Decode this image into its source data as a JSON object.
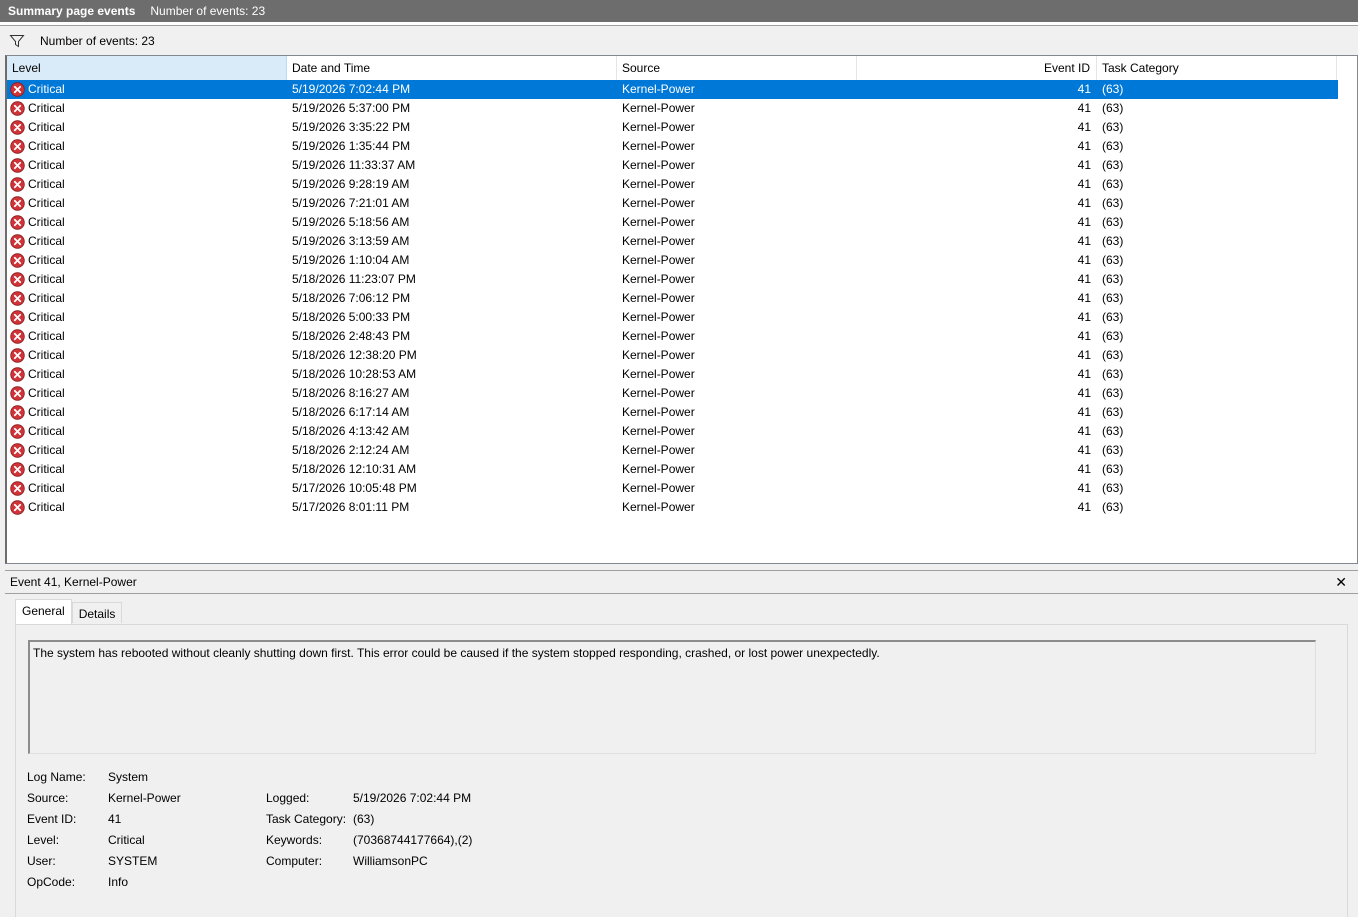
{
  "titlebar": {
    "title": "Summary page events",
    "count_text": "Number of events: 23"
  },
  "filterbar": {
    "icon": "filter-icon",
    "count_text": "Number of events: 23"
  },
  "columns": {
    "level": "Level",
    "datetime": "Date and Time",
    "source": "Source",
    "event_id": "Event ID",
    "task_category": "Task Category"
  },
  "events": [
    {
      "level": "Critical",
      "datetime": "5/19/2026 7:02:44 PM",
      "source": "Kernel-Power",
      "event_id": "41",
      "category": "(63)"
    },
    {
      "level": "Critical",
      "datetime": "5/19/2026 5:37:00 PM",
      "source": "Kernel-Power",
      "event_id": "41",
      "category": "(63)"
    },
    {
      "level": "Critical",
      "datetime": "5/19/2026 3:35:22 PM",
      "source": "Kernel-Power",
      "event_id": "41",
      "category": "(63)"
    },
    {
      "level": "Critical",
      "datetime": "5/19/2026 1:35:44 PM",
      "source": "Kernel-Power",
      "event_id": "41",
      "category": "(63)"
    },
    {
      "level": "Critical",
      "datetime": "5/19/2026 11:33:37 AM",
      "source": "Kernel-Power",
      "event_id": "41",
      "category": "(63)"
    },
    {
      "level": "Critical",
      "datetime": "5/19/2026 9:28:19 AM",
      "source": "Kernel-Power",
      "event_id": "41",
      "category": "(63)"
    },
    {
      "level": "Critical",
      "datetime": "5/19/2026 7:21:01 AM",
      "source": "Kernel-Power",
      "event_id": "41",
      "category": "(63)"
    },
    {
      "level": "Critical",
      "datetime": "5/19/2026 5:18:56 AM",
      "source": "Kernel-Power",
      "event_id": "41",
      "category": "(63)"
    },
    {
      "level": "Critical",
      "datetime": "5/19/2026 3:13:59 AM",
      "source": "Kernel-Power",
      "event_id": "41",
      "category": "(63)"
    },
    {
      "level": "Critical",
      "datetime": "5/19/2026 1:10:04 AM",
      "source": "Kernel-Power",
      "event_id": "41",
      "category": "(63)"
    },
    {
      "level": "Critical",
      "datetime": "5/18/2026 11:23:07 PM",
      "source": "Kernel-Power",
      "event_id": "41",
      "category": "(63)"
    },
    {
      "level": "Critical",
      "datetime": "5/18/2026 7:06:12 PM",
      "source": "Kernel-Power",
      "event_id": "41",
      "category": "(63)"
    },
    {
      "level": "Critical",
      "datetime": "5/18/2026 5:00:33 PM",
      "source": "Kernel-Power",
      "event_id": "41",
      "category": "(63)"
    },
    {
      "level": "Critical",
      "datetime": "5/18/2026 2:48:43 PM",
      "source": "Kernel-Power",
      "event_id": "41",
      "category": "(63)"
    },
    {
      "level": "Critical",
      "datetime": "5/18/2026 12:38:20 PM",
      "source": "Kernel-Power",
      "event_id": "41",
      "category": "(63)"
    },
    {
      "level": "Critical",
      "datetime": "5/18/2026 10:28:53 AM",
      "source": "Kernel-Power",
      "event_id": "41",
      "category": "(63)"
    },
    {
      "level": "Critical",
      "datetime": "5/18/2026 8:16:27 AM",
      "source": "Kernel-Power",
      "event_id": "41",
      "category": "(63)"
    },
    {
      "level": "Critical",
      "datetime": "5/18/2026 6:17:14 AM",
      "source": "Kernel-Power",
      "event_id": "41",
      "category": "(63)"
    },
    {
      "level": "Critical",
      "datetime": "5/18/2026 4:13:42 AM",
      "source": "Kernel-Power",
      "event_id": "41",
      "category": "(63)"
    },
    {
      "level": "Critical",
      "datetime": "5/18/2026 2:12:24 AM",
      "source": "Kernel-Power",
      "event_id": "41",
      "category": "(63)"
    },
    {
      "level": "Critical",
      "datetime": "5/18/2026 12:10:31 AM",
      "source": "Kernel-Power",
      "event_id": "41",
      "category": "(63)"
    },
    {
      "level": "Critical",
      "datetime": "5/17/2026 10:05:48 PM",
      "source": "Kernel-Power",
      "event_id": "41",
      "category": "(63)"
    },
    {
      "level": "Critical",
      "datetime": "5/17/2026 8:01:11 PM",
      "source": "Kernel-Power",
      "event_id": "41",
      "category": "(63)"
    }
  ],
  "selected_index": 0,
  "colors": {
    "selection": "#0078d7",
    "critical_icon": "#d13438",
    "titlebar_bg": "#6d6d6d"
  },
  "detail": {
    "header": "Event 41, Kernel-Power",
    "close_icon": "close-icon",
    "tabs": [
      "General",
      "Details"
    ],
    "active_tab": "General",
    "description": "The system has rebooted without cleanly shutting down first. This error could be caused if the system stopped responding, crashed, or lost power unexpectedly.",
    "labels": {
      "log_name": "Log Name:",
      "source": "Source:",
      "event_id": "Event ID:",
      "level": "Level:",
      "user": "User:",
      "opcode": "OpCode:",
      "logged": "Logged:",
      "task_category": "Task Category:",
      "keywords": "Keywords:",
      "computer": "Computer:"
    },
    "values": {
      "log_name": "System",
      "source": "Kernel-Power",
      "event_id": "41",
      "level": "Critical",
      "user": "SYSTEM",
      "opcode": "Info",
      "logged": "5/19/2026 7:02:44 PM",
      "task_category": "(63)",
      "keywords": "(70368744177664),(2)",
      "computer": "WilliamsonPC"
    }
  }
}
